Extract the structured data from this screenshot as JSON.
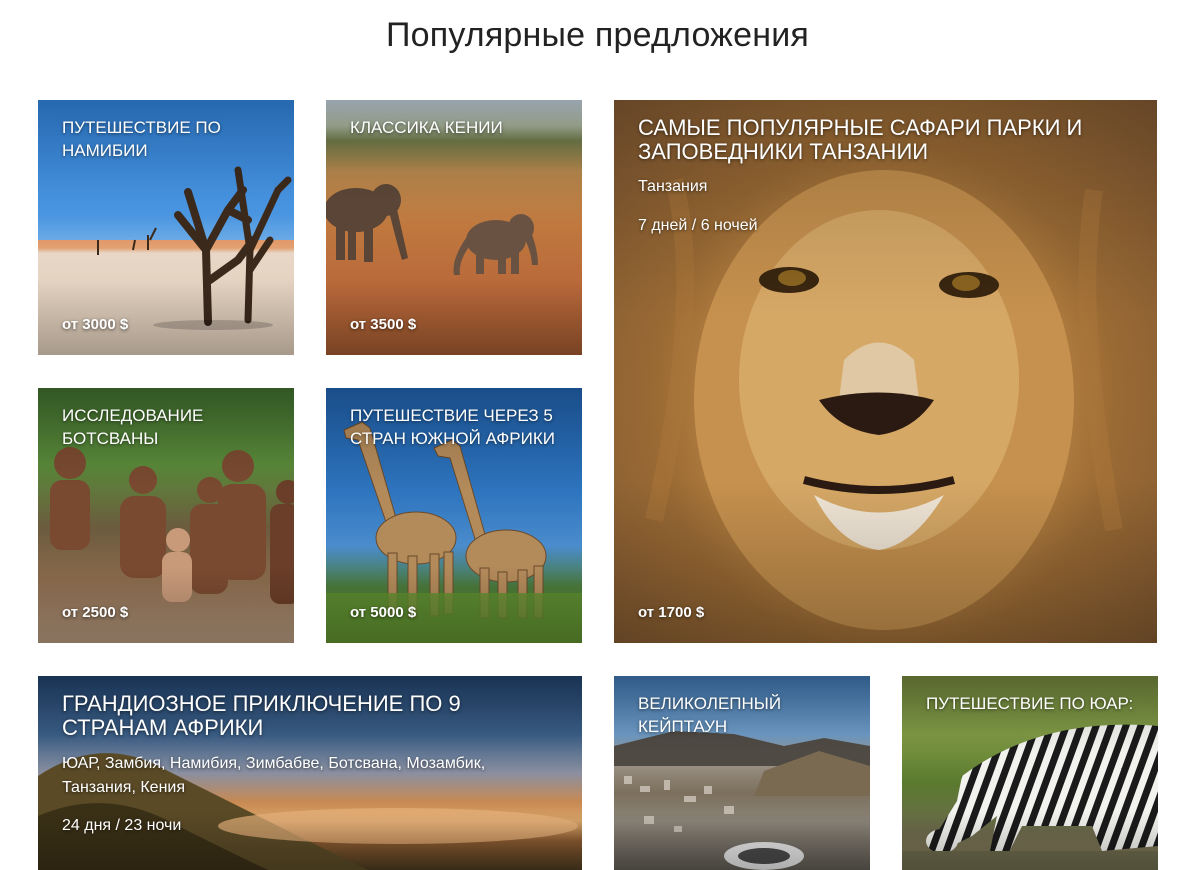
{
  "page": {
    "title": "Популярные предложения"
  },
  "offers": [
    {
      "id": "namibia",
      "title": "Путешествие по Намибии",
      "price": "от 3000 $"
    },
    {
      "id": "kenya",
      "title": "Классика Кении",
      "price": "от 3500 $"
    },
    {
      "id": "tanzania",
      "title": "Самые популярные сафари парки и заповедники Танзании",
      "country": "Танзания",
      "duration": "7 дней / 6 ночей",
      "price": "от 1700 $"
    },
    {
      "id": "botswana",
      "title": "Исследование Ботсваны",
      "price": "от 2500 $"
    },
    {
      "id": "south-africa-5",
      "title": "Путешествие через 5 стран Южной Африки",
      "price": "от 5000 $"
    },
    {
      "id": "africa-9",
      "title": "Грандиозное приключение по 9 странам Африки",
      "countries": "ЮАР, Замбия, Намибия, Зимбабве, Ботсвана, Мозамбик, Танзания, Кения",
      "duration": "24 дня / 23 ночи"
    },
    {
      "id": "cape-town",
      "title": "Великолепный Кейптаун"
    },
    {
      "id": "south-africa",
      "title": "Путешествие по ЮАР:"
    }
  ]
}
